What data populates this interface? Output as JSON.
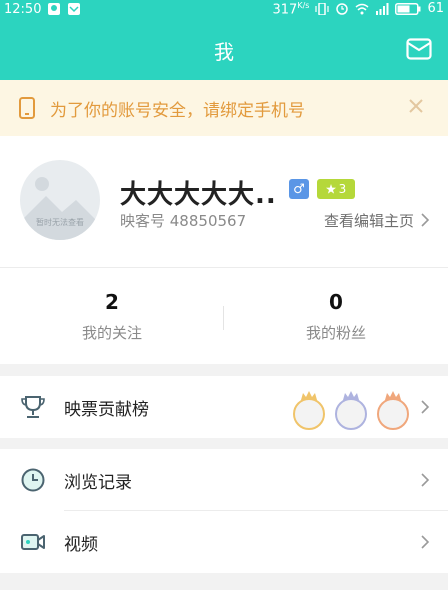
{
  "status_bar": {
    "time": "12:50",
    "speed": "317",
    "speed_unit": "K/s",
    "battery": "61"
  },
  "header": {
    "title": "我",
    "mail_icon": "mail-icon"
  },
  "notice": {
    "text": "为了你的账号安全，请绑定手机号",
    "icon": "phone-icon",
    "close_icon": "close-icon"
  },
  "profile": {
    "avatar_caption": "暂时无法查看",
    "username": "大大大大大..",
    "gender_symbol": "♂",
    "level": "3",
    "id_text": "映客号 48850567",
    "view_home": "查看编辑主页"
  },
  "stats": {
    "following_count": "2",
    "following_label": "我的关注",
    "fans_count": "0",
    "fans_label": "我的粉丝"
  },
  "menu": {
    "ranking_label": "映票贡献榜",
    "history_label": "浏览记录",
    "video_label": "视频"
  },
  "colors": {
    "brand": "#2cd4bf",
    "notice_bg": "#fdf6e3",
    "notice_text": "#e29a3d",
    "gender": "#5a96e6",
    "level": "#b5d83a",
    "medal_gold": "#f0c46a",
    "medal_silver": "#aeb3df",
    "medal_bronze": "#f0a77c"
  }
}
